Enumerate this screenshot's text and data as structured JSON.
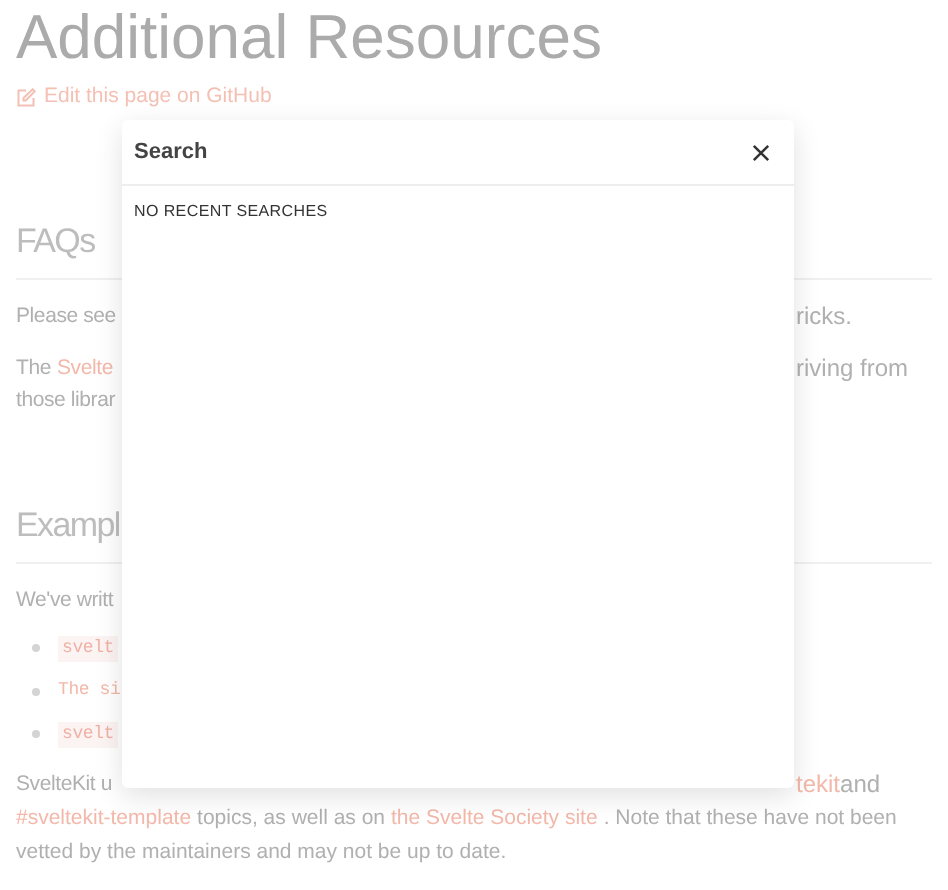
{
  "page": {
    "title": "Additional Resources",
    "edit_link": "Edit this page on GitHub"
  },
  "background_rows": [
    {
      "kind": "heading",
      "left": [
        {
          "kind": "text",
          "text": "FAQs"
        }
      ],
      "right": []
    },
    {
      "kind": "text",
      "left": [
        {
          "kind": "text",
          "text": "Please see"
        }
      ],
      "right": [
        {
          "kind": "text",
          "text": "ricks."
        }
      ]
    },
    {
      "kind": "text",
      "left": [
        {
          "kind": "text",
          "text": "The "
        },
        {
          "kind": "link",
          "text": "Svelte"
        }
      ],
      "right": [
        {
          "kind": "text",
          "text": "riving from"
        }
      ]
    },
    {
      "kind": "text",
      "left": [
        {
          "kind": "text",
          "text": "those librar"
        }
      ],
      "right": []
    },
    {
      "kind": "heading",
      "left": [
        {
          "kind": "text",
          "text": "Exampl"
        }
      ],
      "right": []
    },
    {
      "kind": "text",
      "left": [
        {
          "kind": "text",
          "text": "We've writt"
        }
      ],
      "right": []
    },
    {
      "kind": "bullet",
      "left": [
        {
          "kind": "code",
          "text": "svelt"
        }
      ],
      "right": []
    },
    {
      "kind": "bullet",
      "left": [
        {
          "kind": "link_code",
          "text": "The si"
        }
      ],
      "right": []
    },
    {
      "kind": "bullet",
      "left": [
        {
          "kind": "code",
          "text": "svelt"
        }
      ],
      "right": []
    },
    {
      "kind": "text",
      "left": [
        {
          "kind": "text",
          "text": "SvelteKit u"
        }
      ],
      "right": [
        {
          "kind": "link",
          "text": "tekit"
        },
        {
          "kind": "text",
          "text": " and"
        }
      ]
    }
  ],
  "closing_lines": [
    [
      {
        "kind": "link",
        "text": "#sveltekit-template"
      },
      {
        "kind": "text",
        "text": "topics, as well as on"
      },
      {
        "kind": "link",
        "text": "the Svelte Society site"
      },
      {
        "kind": "text",
        "text": ". Note that these have not been"
      }
    ],
    [
      {
        "kind": "text",
        "text": "vetted by the maintainers and may not be up to date."
      }
    ]
  ],
  "search_dialog": {
    "title": "Search",
    "empty_label": "NO RECENT SEARCHES"
  }
}
